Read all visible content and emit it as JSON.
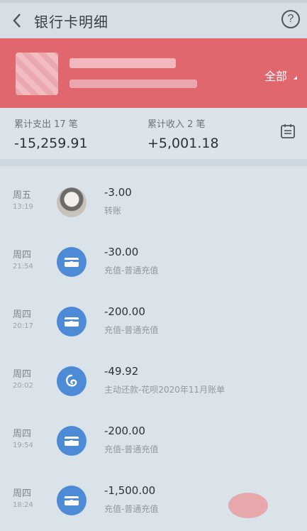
{
  "nav": {
    "title": "银行卡明细",
    "help_label": "?"
  },
  "card": {
    "filter_label": "全部"
  },
  "summary": {
    "expense_label": "累计支出 17 笔",
    "expense_value": "-15,259.91",
    "income_label": "累计收入 2 笔",
    "income_value": "+5,001.18"
  },
  "transactions": [
    {
      "day": "周五",
      "time": "13:19",
      "amount": "-3.00",
      "desc": "转账",
      "icon": "user-avatar"
    },
    {
      "day": "周四",
      "time": "21:54",
      "amount": "-30.00",
      "desc": "充值-普通充值",
      "icon": "wallet-icon"
    },
    {
      "day": "周四",
      "time": "20:17",
      "amount": "-200.00",
      "desc": "充值-普通充值",
      "icon": "wallet-icon"
    },
    {
      "day": "周四",
      "time": "20:02",
      "amount": "-49.92",
      "desc": "主动还款-花呗2020年11月账单",
      "icon": "huabei-icon"
    },
    {
      "day": "周四",
      "time": "19:54",
      "amount": "-200.00",
      "desc": "充值-普通充值",
      "icon": "wallet-icon"
    },
    {
      "day": "周四",
      "time": "18:24",
      "amount": "-1,500.00",
      "desc": "充值-普通充值",
      "icon": "wallet-icon"
    }
  ],
  "colors": {
    "header_red": "#e0676e",
    "icon_blue": "#4d8bd6"
  }
}
